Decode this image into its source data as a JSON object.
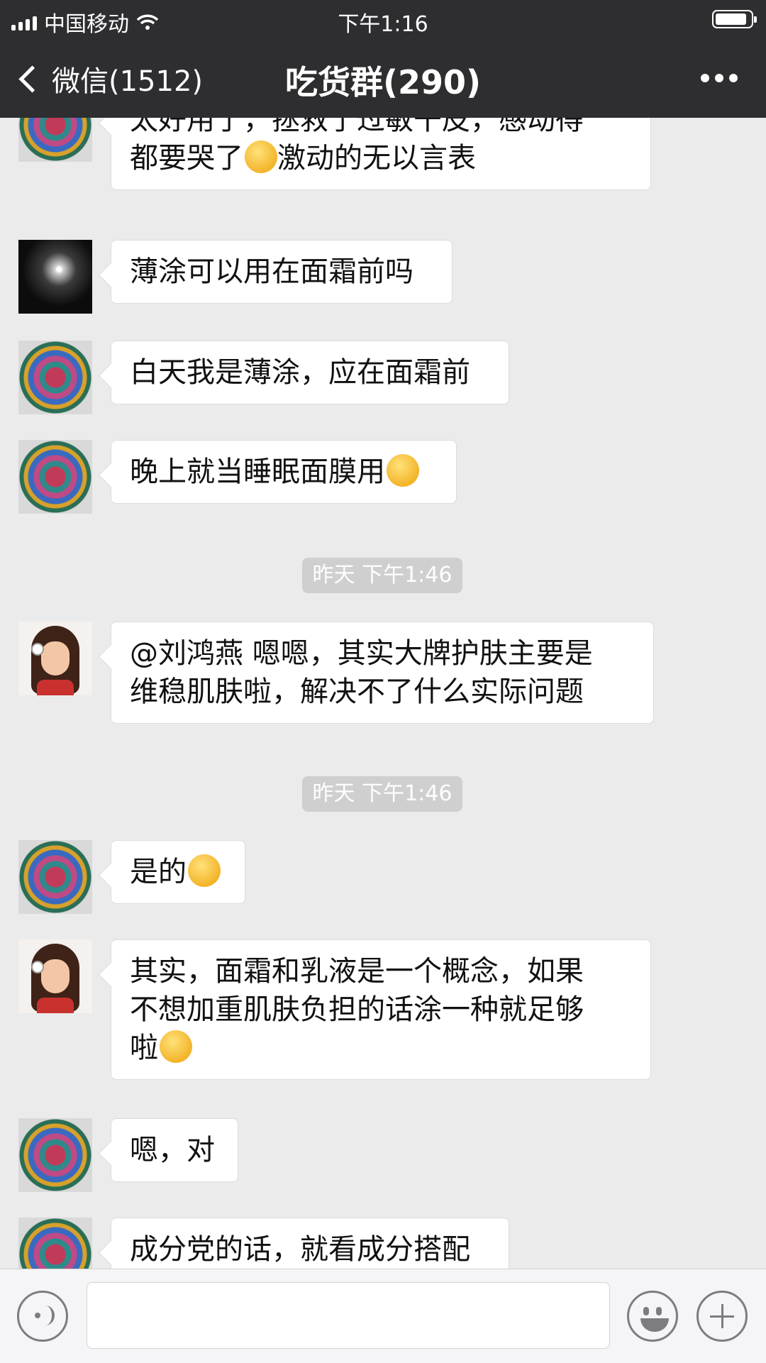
{
  "status_bar": {
    "carrier": "中国移动",
    "time": "下午1:16",
    "battery_percent": 90
  },
  "nav": {
    "back_label": "微信(1512)",
    "title": "吃货群(290)"
  },
  "messages": [
    {
      "kind": "message",
      "avatar": "mandala-avatar",
      "text": "太好用了，拯救了过敏干皮，感动得\n都要哭了",
      "emoji": "tears-of-joy-emoji",
      "after": "激动的无以言表"
    },
    {
      "kind": "message",
      "avatar": "sparkle-avatar",
      "text": "薄涂可以用在面霜前吗"
    },
    {
      "kind": "message",
      "avatar": "mandala-avatar",
      "text": "白天我是薄涂，应在面霜前"
    },
    {
      "kind": "message",
      "avatar": "mandala-avatar",
      "text": "晚上就当睡眠面膜用",
      "emoji": "facepalm-emoji"
    },
    {
      "kind": "timestamp",
      "text": "昨天 下午1:46"
    },
    {
      "kind": "message",
      "avatar": "girl-avatar",
      "text": "@刘鸿燕 嗯嗯，其实大牌护肤主要是\n维稳肌肤啦，解决不了什么实际问题"
    },
    {
      "kind": "timestamp",
      "text": "昨天 下午1:46"
    },
    {
      "kind": "message",
      "avatar": "mandala-avatar",
      "text": "是的",
      "emoji": "facepalm-emoji"
    },
    {
      "kind": "message",
      "avatar": "girl-avatar",
      "text": "其实，面霜和乳液是一个概念，如果\n不想加重肌肤负担的话涂一种就足够\n啦",
      "emoji": "smile-emoji"
    },
    {
      "kind": "message",
      "avatar": "mandala-avatar",
      "text": "嗯，对"
    },
    {
      "kind": "message",
      "avatar": "mandala-avatar",
      "text": "成分党的话，就看成分搭配"
    }
  ],
  "input_bar": {
    "value": "",
    "voice_icon": "voice-icon",
    "emoji_icon": "emoji-icon",
    "plus_icon": "plus-icon"
  }
}
